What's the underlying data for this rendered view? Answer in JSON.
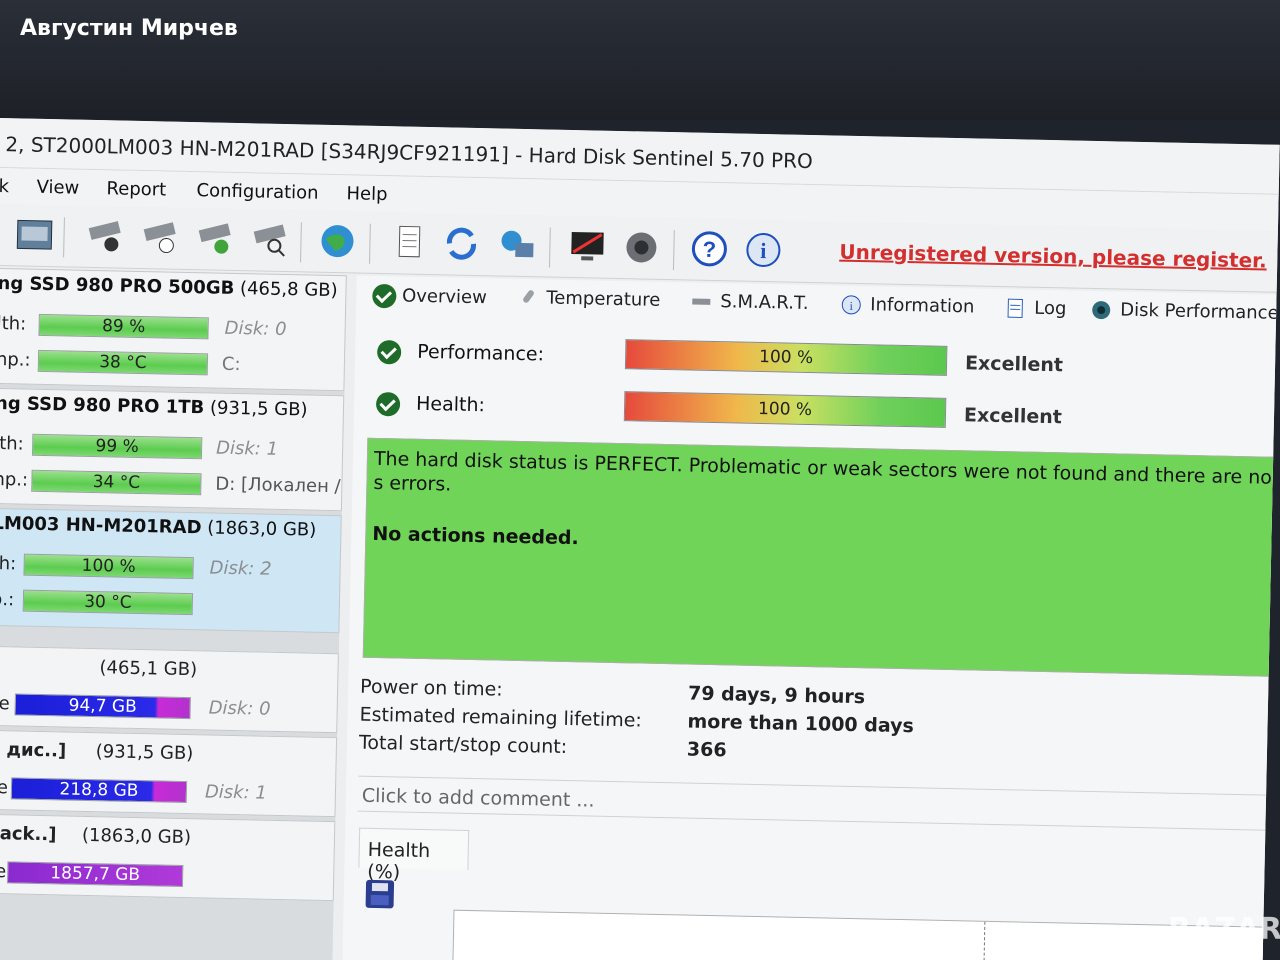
{
  "poster": {
    "name": "Августин Мирчев"
  },
  "window": {
    "title": "2, ST2000LM003 HN-M201RAD [S34RJ9CF921191]  -  Hard Disk Sentinel 5.70 PRO"
  },
  "menu": {
    "items": [
      "k",
      "View",
      "Report",
      "Configuration",
      "Help"
    ]
  },
  "toolbar": {
    "register_link": "Unregistered version, please register."
  },
  "disks": [
    {
      "title_bold": "ng SSD 980 PRO 500GB",
      "size": "(465,8 GB)",
      "rows": [
        {
          "label": "lth:",
          "value": "89 %",
          "meta": "Disk: 0"
        },
        {
          "label": "np.:",
          "value": "38 °C",
          "meta": "C:"
        }
      ]
    },
    {
      "title_bold": "ng SSD 980 PRO 1TB",
      "size": "(931,5 GB)",
      "rows": [
        {
          "label": "lth:",
          "value": "99 %",
          "meta": "Disk: 1"
        },
        {
          "label": "np.:",
          "value": "34 °C",
          "meta": "D: [Локален /"
        }
      ]
    },
    {
      "title_bold": "LM003 HN-M201RAD",
      "size": "(1863,0 GB)",
      "rows": [
        {
          "label": "th:",
          "value": "100 %",
          "meta": "Disk: 2"
        },
        {
          "label": "p.:",
          "value": "30 °C",
          "meta": ""
        }
      ]
    }
  ],
  "volumes": [
    {
      "name": "",
      "size": "(465,1 GB)",
      "label": "ce",
      "free": "94,7 GB",
      "disk": "Disk: 0"
    },
    {
      "name": "н дис..]",
      "size": "(931,5 GB)",
      "label": "ce",
      "free": "218,8 GB",
      "disk": "Disk: 1"
    },
    {
      "name": "Back..]",
      "size": "(1863,0 GB)",
      "label": "ce",
      "free": "1857,7 GB",
      "disk": ""
    }
  ],
  "tabs": [
    "Overview",
    "Temperature",
    "S.M.A.R.T.",
    "Information",
    "Log",
    "Disk Performance"
  ],
  "overview": {
    "performance": {
      "label": "Performance:",
      "value": "100 %",
      "status": "Excellent"
    },
    "health": {
      "label": "Health:",
      "value": "100 %",
      "status": "Excellent"
    },
    "status_message": "The hard disk status is PERFECT. Problematic or weak sectors were not found and there are no s errors.",
    "status_action": "No actions needed.",
    "info": [
      {
        "label": "Power on time:",
        "value": "79 days, 9 hours"
      },
      {
        "label": "Estimated remaining lifetime:",
        "value": "more than 1000 days"
      },
      {
        "label": "Total start/stop count:",
        "value": "366"
      }
    ],
    "comment_placeholder": "Click to add comment ...",
    "health_tab": "Health (%)"
  },
  "watermark": "BAZAR",
  "colors": {
    "accent_green": "#6fd457",
    "register_red": "#d32f2f",
    "check_green": "#1e6b2a"
  }
}
